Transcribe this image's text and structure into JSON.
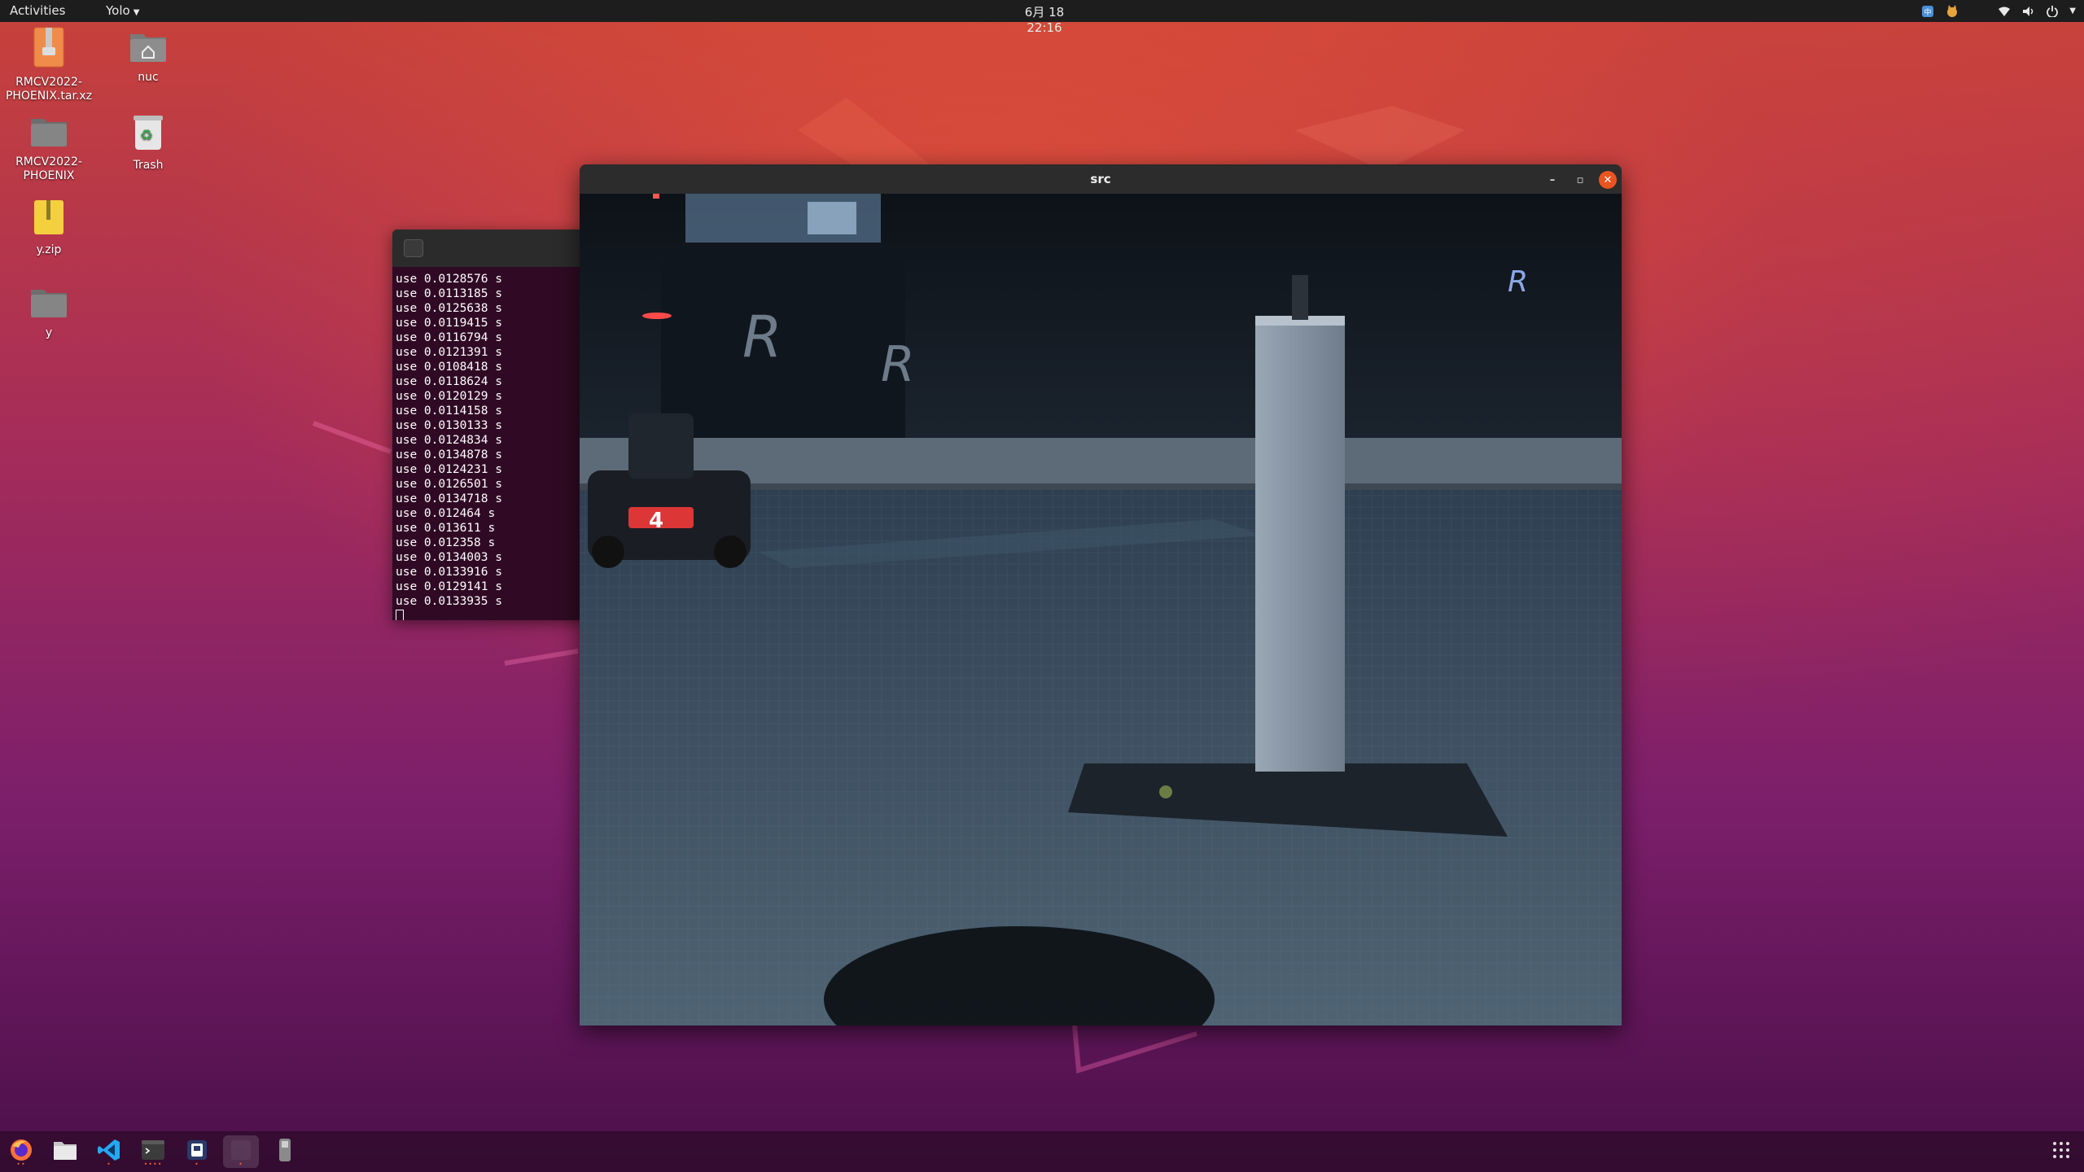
{
  "topbar": {
    "activities": "Activities",
    "app_menu": "Yolo",
    "clock": "6月 18 22:16",
    "tray_icons": [
      "screen-share-icon",
      "cat-app-icon",
      "network-icon",
      "volume-icon",
      "power-icon",
      "chevron-down-icon"
    ]
  },
  "desktop": {
    "icons": [
      {
        "label": "RMCV2022-PHOENIX.tar.xz",
        "icon": "archive-icon"
      },
      {
        "label": "nuc",
        "icon": "home-folder-icon"
      },
      {
        "label": "RMCV2022-PHOENIX",
        "icon": "folder-icon"
      },
      {
        "label": "Trash",
        "icon": "trash-icon"
      },
      {
        "label": "y.zip",
        "icon": "zip-icon"
      },
      {
        "label": "y",
        "icon": "folder-icon"
      }
    ]
  },
  "terminal": {
    "lines": [
      "use 0.0128576 s",
      "use 0.0113185 s",
      "use 0.0125638 s",
      "use 0.0119415 s",
      "use 0.0116794 s",
      "use 0.0121391 s",
      "use 0.0108418 s",
      "use 0.0118624 s",
      "use 0.0120129 s",
      "use 0.0114158 s",
      "use 0.0130133 s",
      "use 0.0124834 s",
      "use 0.0134878 s",
      "use 0.0124231 s",
      "use 0.0126501 s",
      "use 0.0134718 s",
      "use 0.012464 s",
      "use 0.013611 s",
      "use 0.012358 s",
      "use 0.0134003 s",
      "use 0.0133916 s",
      "use 0.0129141 s",
      "use 0.0133935 s"
    ]
  },
  "video_window": {
    "title": "src",
    "car_number": "4"
  },
  "dock": {
    "items": [
      {
        "name": "firefox-icon",
        "dots": "••"
      },
      {
        "name": "files-icon",
        "dots": ""
      },
      {
        "name": "vscode-icon",
        "dots": "•"
      },
      {
        "name": "terminal-icon",
        "dots": "••••"
      },
      {
        "name": "app-icon",
        "dots": "•"
      },
      {
        "name": "video-window-icon",
        "dots": "•",
        "active": true
      },
      {
        "name": "usb-drive-icon",
        "dots": ""
      }
    ],
    "apps_grid": "show-applications-icon"
  },
  "colors": {
    "terminal_bg": "#300a24",
    "accent": "#f05a28",
    "close_button": "#e95420"
  }
}
